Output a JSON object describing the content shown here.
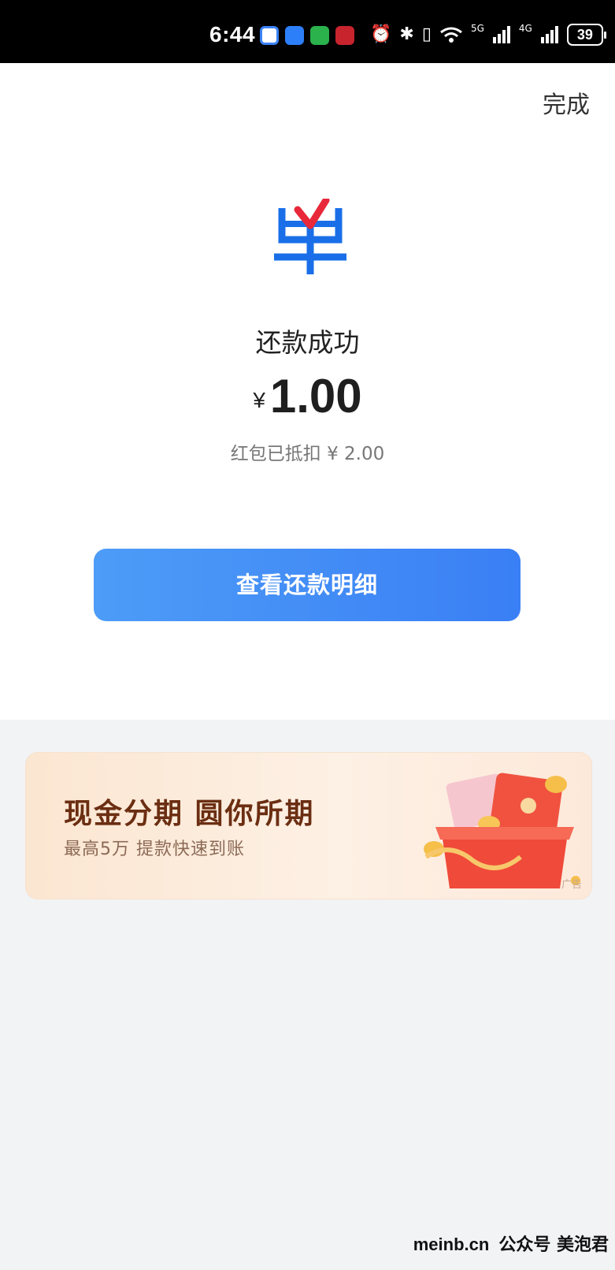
{
  "status_bar": {
    "time": "6:44",
    "battery": "39",
    "network_labels": [
      "5G",
      "4G"
    ]
  },
  "header": {
    "done_label": "完成"
  },
  "result": {
    "title": "还款成功",
    "currency": "¥",
    "amount": "1.00",
    "discount_text": "红包已抵扣 ¥ 2.00"
  },
  "actions": {
    "view_details_label": "查看还款明细"
  },
  "ad": {
    "title": "现金分期  圆你所期",
    "subtitle": "最高5万  提款快速到账",
    "tag": "广告"
  },
  "watermark": {
    "site": "meinb.cn",
    "account": "公众号 美泡君"
  },
  "colors": {
    "primary_button": "#3a7ff5",
    "logo_blue": "#1a6fe8",
    "logo_red": "#e8283a",
    "ad_title": "#6b2e12"
  }
}
